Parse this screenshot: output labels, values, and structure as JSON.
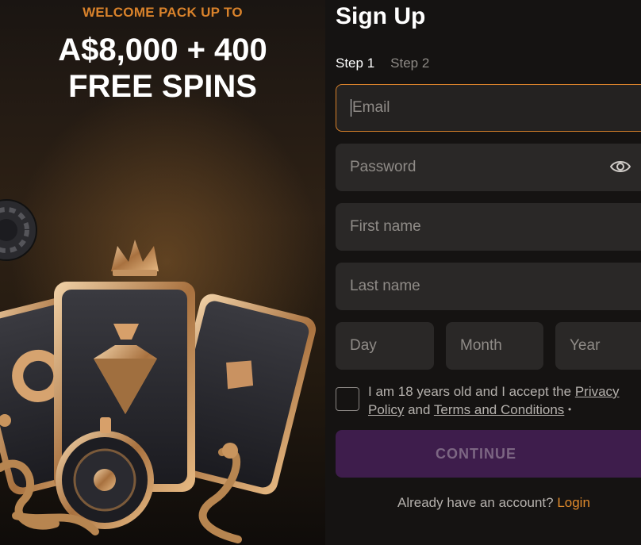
{
  "promo": {
    "kicker": "WELCOME PACK UP TO",
    "amount": "A$8,000 + 400",
    "spins": "FREE SPINS"
  },
  "signup": {
    "title": "Sign Up",
    "steps": [
      "Step 1",
      "Step 2"
    ],
    "active_step": "Step 1",
    "email_placeholder": "Email",
    "password_placeholder": "Password",
    "first_name_placeholder": "First name",
    "last_name_placeholder": "Last name",
    "day_placeholder": "Day",
    "month_placeholder": "Month",
    "year_placeholder": "Year",
    "terms_prefix": "I am 18 years old and I accept the ",
    "privacy_link": "Privacy Policy",
    "terms_and": " and ",
    "terms_link": "Terms and Conditions",
    "required_mark": "•",
    "continue_label": "CONTINUE",
    "login_prompt": "Already have an account? ",
    "login_link": "Login"
  },
  "colors": {
    "accent": "#d9822b",
    "background": "#151312",
    "field": "#2a2827",
    "continue_bg": "#3e1d4c"
  }
}
